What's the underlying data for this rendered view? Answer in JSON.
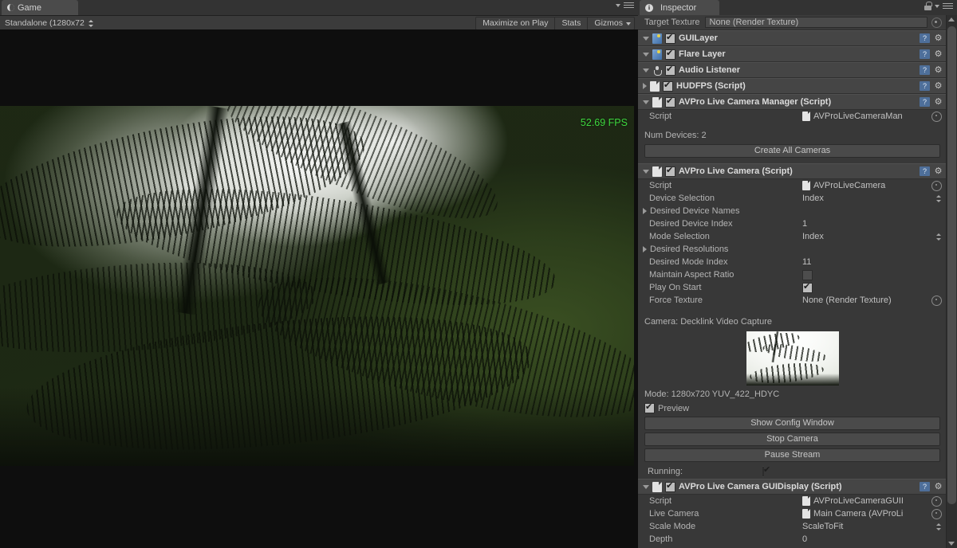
{
  "game_panel": {
    "tab": {
      "label": "Game",
      "icon": "moon-icon"
    },
    "toolbar": {
      "aspect_value": "Standalone (1280x72",
      "maximize_on_play": "Maximize on Play",
      "stats": "Stats",
      "gizmos": "Gizmos"
    },
    "overlay": {
      "fps": "52.69 FPS",
      "fps_color": "#3ed83e"
    }
  },
  "inspector": {
    "tab": {
      "label": "Inspector",
      "icon": "info-icon"
    },
    "target_texture": {
      "label": "Target Texture",
      "value": "None (Render Texture)"
    },
    "components": [
      {
        "name": "GUILayer",
        "enabled": true,
        "expanded": true,
        "icon": "gui-layer-icon"
      },
      {
        "name": "Flare Layer",
        "enabled": true,
        "expanded": true,
        "icon": "flare-layer-icon"
      },
      {
        "name": "Audio Listener",
        "enabled": true,
        "expanded": true,
        "icon": "audio-listener-icon"
      },
      {
        "name": "HUDFPS (Script)",
        "enabled": true,
        "expanded": false,
        "icon": "script-icon"
      }
    ],
    "manager": {
      "title": "AVPro Live Camera Manager (Script)",
      "enabled": true,
      "expanded": true,
      "script_label": "Script",
      "script_value": "AVProLiveCameraMan",
      "num_devices": "Num Devices: 2",
      "create_all_cameras": "Create All Cameras"
    },
    "live_camera": {
      "title": "AVPro Live Camera (Script)",
      "enabled": true,
      "expanded": true,
      "properties": [
        {
          "label": "Script",
          "value": "AVProLiveCamera",
          "kind": "objref"
        },
        {
          "label": "Device Selection",
          "value": "Index",
          "kind": "enum"
        },
        {
          "label": "Desired Device Names",
          "value": "",
          "kind": "foldout"
        },
        {
          "label": "Desired Device Index",
          "value": "1",
          "kind": "number"
        },
        {
          "label": "Mode Selection",
          "value": "Index",
          "kind": "enum"
        },
        {
          "label": "Desired Resolutions",
          "value": "",
          "kind": "foldout"
        },
        {
          "label": "Desired Mode Index",
          "value": "11",
          "kind": "number"
        },
        {
          "label": "Maintain Aspect Ratio",
          "value": false,
          "kind": "checkbox"
        },
        {
          "label": "Play On Start",
          "value": true,
          "kind": "checkbox"
        },
        {
          "label": "Force Texture",
          "value": "None (Render Texture)",
          "kind": "objref"
        }
      ],
      "camera_line": "Camera: Decklink Video Capture",
      "mode_line": "Mode: 1280x720 YUV_422_HDYC",
      "preview_label": "Preview",
      "preview_checked": true,
      "buttons": [
        "Show Config Window",
        "Stop Camera",
        "Pause Stream"
      ],
      "running_label": "Running:",
      "running_value": true
    },
    "gui_display": {
      "title": "AVPro Live Camera GUIDisplay (Script)",
      "enabled": true,
      "expanded": true,
      "properties": [
        {
          "label": "Script",
          "value": "AVProLiveCameraGUII",
          "kind": "objref"
        },
        {
          "label": "Live Camera",
          "value": "Main Camera (AVProLi",
          "kind": "objref"
        },
        {
          "label": "Scale Mode",
          "value": "ScaleToFit",
          "kind": "enum"
        },
        {
          "label": "Depth",
          "value": "0",
          "kind": "number"
        }
      ]
    }
  }
}
